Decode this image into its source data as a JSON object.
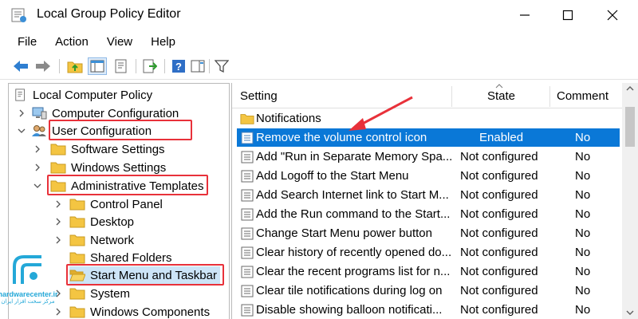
{
  "window": {
    "title": "Local Group Policy Editor"
  },
  "menu": [
    "File",
    "Action",
    "View",
    "Help"
  ],
  "tree": {
    "root": "Local Computer Policy",
    "items": [
      {
        "label": "Computer Configuration",
        "icon": "computer-icon"
      },
      {
        "label": "User Configuration",
        "icon": "users-icon"
      },
      {
        "label": "Software Settings",
        "icon": "folder-icon"
      },
      {
        "label": "Windows Settings",
        "icon": "folder-icon"
      },
      {
        "label": "Administrative Templates",
        "icon": "folder-icon"
      },
      {
        "label": "Control Panel",
        "icon": "folder-icon"
      },
      {
        "label": "Desktop",
        "icon": "folder-icon"
      },
      {
        "label": "Network",
        "icon": "folder-icon"
      },
      {
        "label": "Shared Folders",
        "icon": "folder-icon"
      },
      {
        "label": "Start Menu and Taskbar",
        "icon": "folder-open-icon"
      },
      {
        "label": "System",
        "icon": "folder-icon"
      },
      {
        "label": "Windows Components",
        "icon": "folder-icon"
      }
    ]
  },
  "list": {
    "columns": {
      "setting": "Setting",
      "state": "State",
      "comment": "Comment"
    },
    "folder_row": "Notifications",
    "rows": [
      {
        "setting": "Remove the volume control icon",
        "state": "Enabled",
        "comment": "No"
      },
      {
        "setting": "Add \"Run in Separate Memory Spa...",
        "state": "Not configured",
        "comment": "No"
      },
      {
        "setting": "Add Logoff to the Start Menu",
        "state": "Not configured",
        "comment": "No"
      },
      {
        "setting": "Add Search Internet link to Start M...",
        "state": "Not configured",
        "comment": "No"
      },
      {
        "setting": "Add the Run command to the Start...",
        "state": "Not configured",
        "comment": "No"
      },
      {
        "setting": "Change Start Menu power button",
        "state": "Not configured",
        "comment": "No"
      },
      {
        "setting": "Clear history of recently opened do...",
        "state": "Not configured",
        "comment": "No"
      },
      {
        "setting": "Clear the recent programs list for n...",
        "state": "Not configured",
        "comment": "No"
      },
      {
        "setting": "Clear tile notifications during log on",
        "state": "Not configured",
        "comment": "No"
      },
      {
        "setting": "Disable showing balloon notificati...",
        "state": "Not configured",
        "comment": "No"
      }
    ]
  },
  "watermark": {
    "brand": "hardwarecenter.ir",
    "subtitle": "مرکز سخت افزار ایران"
  },
  "colors": {
    "selection": "#0a78d7",
    "highlight": "#e8313a",
    "arrow": "#e8313a",
    "folder": "#f4c542",
    "accent": "#24a8d8"
  }
}
